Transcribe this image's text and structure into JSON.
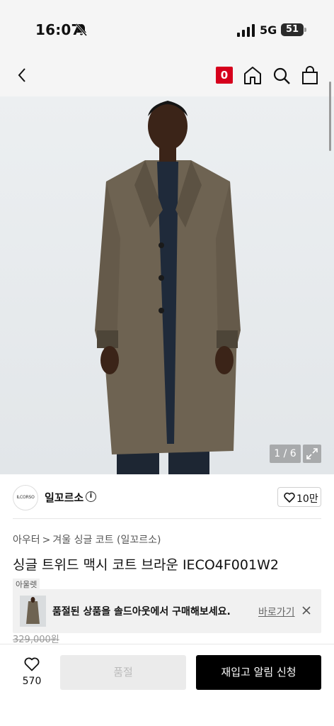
{
  "status_bar": {
    "time": "16:07",
    "network": "5G",
    "battery": "51"
  },
  "nav": {
    "cart_count": "0",
    "icons": [
      "back-icon",
      "home-icon",
      "search-icon",
      "shopping-bag-icon"
    ]
  },
  "gallery": {
    "counter": "1 / 6"
  },
  "brand": {
    "logo_text": "ILCORSO",
    "name": "일꼬르소",
    "likes": "10만"
  },
  "breadcrumb": {
    "level1": "아우터",
    "separator": ">",
    "level2": "겨울 싱글 코트 (일꼬르소)"
  },
  "product": {
    "title": "싱글 트위드 맥시 코트 브라운 IECO4F001W2",
    "tag": "아울렛",
    "price": "329,000원"
  },
  "banner": {
    "message": "품절된 상품을 솔드아웃에서 구매해보세요.",
    "link": "바로가기"
  },
  "bottom_bar": {
    "wish_count": "570",
    "soldout_label": "품절",
    "restock_label": "재입고 알림 신청"
  },
  "colors": {
    "accent_red": "#d6001c",
    "primary_button": "#000000",
    "disabled_button": "#ebebeb",
    "coat": "#6e6352"
  }
}
